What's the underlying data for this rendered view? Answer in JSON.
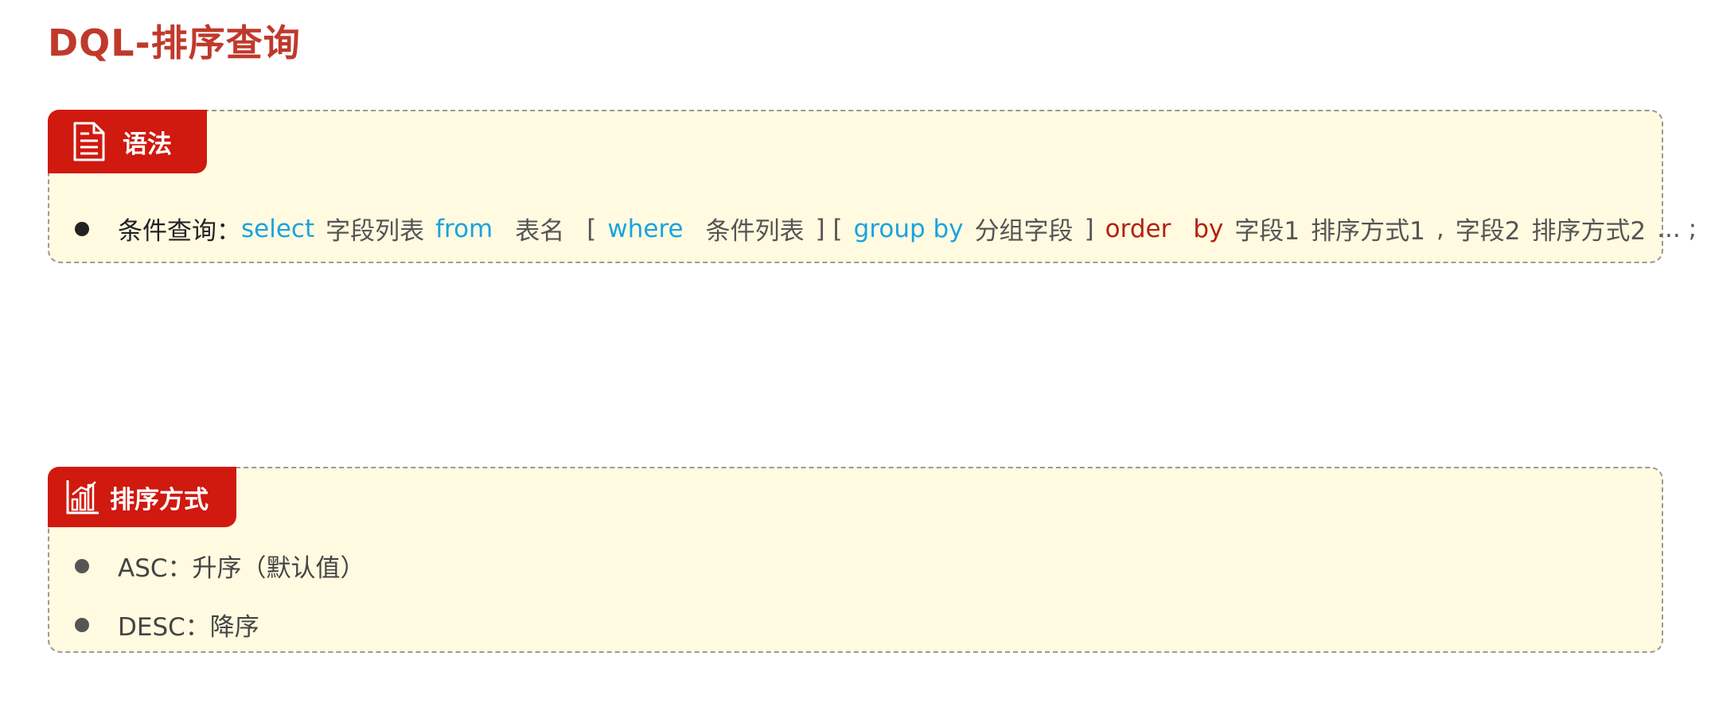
{
  "title": "DQL-排序查询",
  "syntax_panel": {
    "tab_label": "语法",
    "icon": "document-icon",
    "line": {
      "label": "条件查询：",
      "select": "select",
      "field_list": "字段列表",
      "from": "from",
      "table_name": "表名",
      "bracket_open_1": "[",
      "where": "where",
      "condition_list": "条件列表",
      "bracket_mid": "] [",
      "group_by": "group by",
      "group_field": "分组字段",
      "bracket_close": "]",
      "order": "order",
      "by": "by",
      "field1": "字段1",
      "sort_method1": "排序方式1",
      "comma": ",",
      "field2": "字段2",
      "sort_method2": "排序方式2",
      "ellipsis": "... ;"
    }
  },
  "order_panel": {
    "tab_label": "排序方式",
    "icon": "bar-chart-icon",
    "items": [
      "ASC：升序（默认值）",
      "DESC：降序"
    ]
  },
  "colors": {
    "title": "#c0392b",
    "tab_bg": "#d0190f",
    "panel_bg": "#fffae0",
    "keyword_blue": "#1aa3e0",
    "keyword_red": "#b5200f"
  }
}
